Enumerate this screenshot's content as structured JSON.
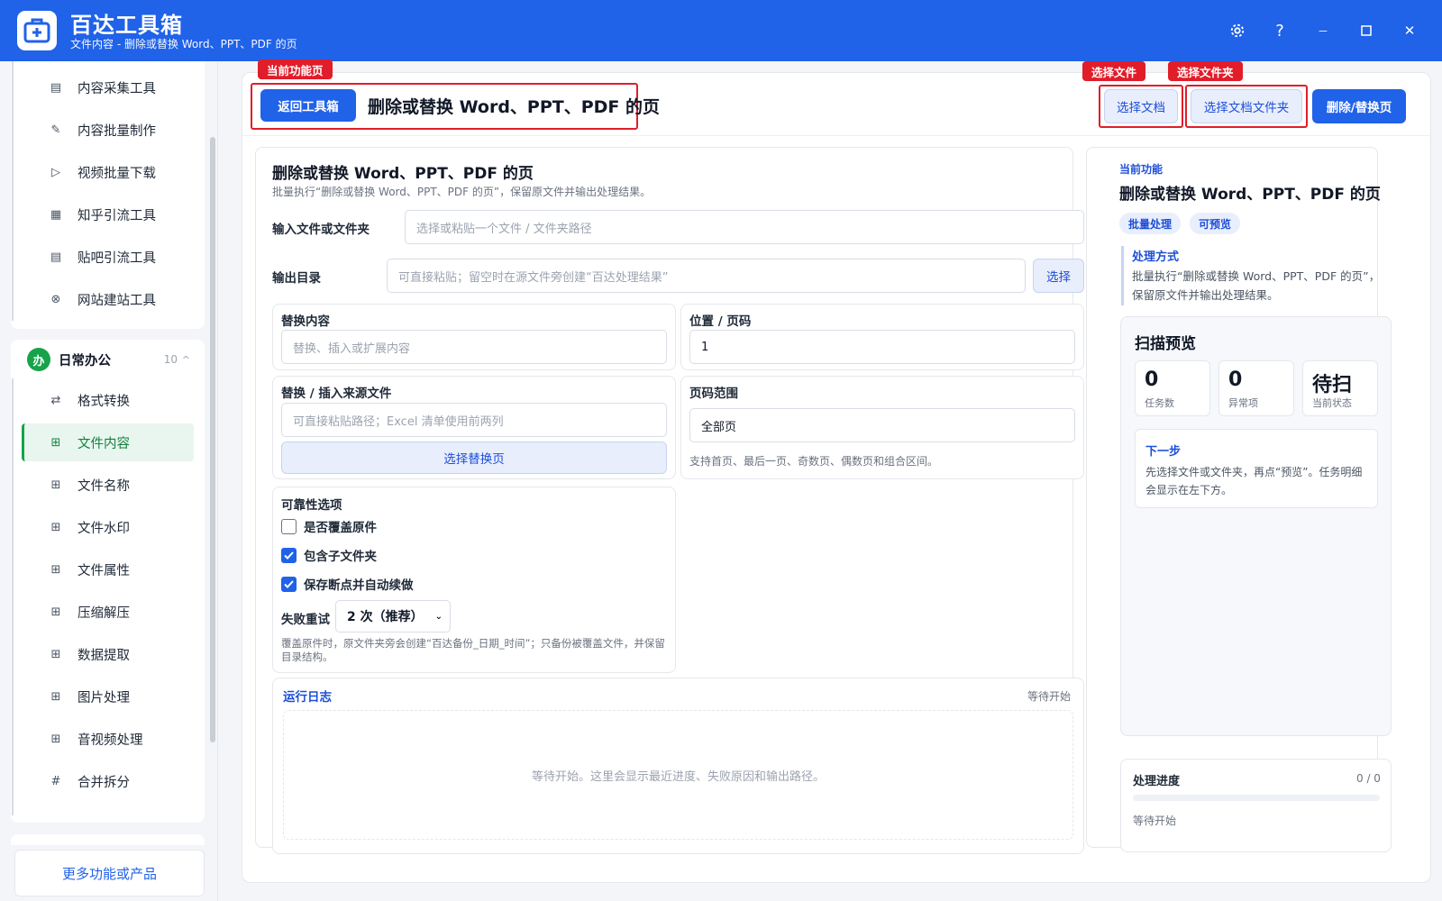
{
  "titlebar": {
    "app_title": "百达工具箱",
    "subtitle": "文件内容 - 删除或替换 Word、PPT、PDF 的页",
    "settings_icon": "gear-icon",
    "help_label": "?",
    "minimize_label": "－",
    "maximize_icon": "square-icon",
    "close_label": "✕"
  },
  "sidebar": {
    "group1_items": [
      {
        "label": "内容采集工具",
        "icon": "▤"
      },
      {
        "label": "内容批量制作",
        "icon": "✎"
      },
      {
        "label": "视频批量下载",
        "icon": "▷"
      },
      {
        "label": "知乎引流工具",
        "icon": "▦"
      },
      {
        "label": "贴吧引流工具",
        "icon": "▤"
      },
      {
        "label": "网站建站工具",
        "icon": "⊗"
      }
    ],
    "group2": {
      "icon_text": "办",
      "title": "日常办公",
      "count": "10",
      "chevron": "^"
    },
    "group2_items": [
      {
        "label": "格式转换",
        "icon": "⇄"
      },
      {
        "label": "文件内容",
        "icon": "⊞"
      },
      {
        "label": "文件名称",
        "icon": "⊞"
      },
      {
        "label": "文件水印",
        "icon": "⊞"
      },
      {
        "label": "文件属性",
        "icon": "⊞"
      },
      {
        "label": "压缩解压",
        "icon": "⊞"
      },
      {
        "label": "数据提取",
        "icon": "⊞"
      },
      {
        "label": "图片处理",
        "icon": "⊞"
      },
      {
        "label": "音视频处理",
        "icon": "⊞"
      },
      {
        "label": "合并拆分",
        "icon": "#"
      }
    ],
    "active_item": "文件内容",
    "more_label": "更多功能或产品"
  },
  "toolbar": {
    "badge_current": "当前功能页",
    "badge_select_file": "选择文件",
    "badge_select_folder": "选择文件夹",
    "back_label": "返回工具箱",
    "page_title": "删除或替换 Word、PPT、PDF 的页",
    "select_doc_label": "选择文档",
    "select_folder_label": "选择文档文件夹",
    "run_label": "删除/替换页"
  },
  "form": {
    "title": "删除或替换 Word、PPT、PDF 的页",
    "desc": "批量执行“删除或替换 Word、PPT、PDF 的页”，保留原文件并输出处理结果。",
    "input_label": "输入文件或文件夹",
    "input_placeholder": "选择或粘贴一个文件 / 文件夹路径",
    "output_label": "输出目录",
    "output_placeholder": "可直接粘贴；留空时在源文件旁创建“百达处理结果”",
    "output_button": "选择",
    "replace_label": "替换内容",
    "replace_placeholder": "替换、插入或扩展内容",
    "position_label": "位置 / 页码",
    "position_value": "1",
    "source_label": "替换 / 插入来源文件",
    "source_placeholder": "可直接粘贴路径；Excel 清单使用前两列",
    "source_button": "选择替换页",
    "range_label": "页码范围",
    "range_value": "全部页",
    "range_hint": "支持首页、最后一页、奇数页、偶数页和组合区间。",
    "reliability_label": "可靠性选项",
    "opt_overwrite": "是否覆盖原件",
    "opt_subfolder": "包含子文件夹",
    "opt_resume": "保存断点并自动续做",
    "retry_label": "失败重试",
    "retry_value": "2 次（推荐）",
    "note": "覆盖原件时，原文件夹旁会创建“百达备份_日期_时间”；只备份被覆盖文件，并保留目录结构。"
  },
  "log": {
    "title": "运行日志",
    "status": "等待开始",
    "empty": "等待开始。这里会显示最近进度、失败原因和输出路径。"
  },
  "side": {
    "kicker": "当前功能",
    "title": "删除或替换 Word、PPT、PDF 的页",
    "tags": [
      "批量处理",
      "可预览"
    ],
    "method_title": "处理方式",
    "method_desc": "批量执行“删除或替换 Word、PPT、PDF 的页”，保留原文件并输出处理结果。",
    "preview_title": "扫描预览",
    "stats": [
      {
        "value": "0",
        "label": "任务数"
      },
      {
        "value": "0",
        "label": "异常项"
      },
      {
        "value": "待扫",
        "label": "当前状态"
      }
    ],
    "next_title": "下一步",
    "next_desc": "先选择文件或文件夹，再点“预览”。任务明细会显示在左下方。",
    "progress_title": "处理进度",
    "progress_value": "0 / 0",
    "progress_fraction": 0,
    "progress_status": "等待开始"
  },
  "colors": {
    "brand": "#2062e8",
    "accent_green": "#16a34a",
    "badge_red": "#e11d2a"
  }
}
